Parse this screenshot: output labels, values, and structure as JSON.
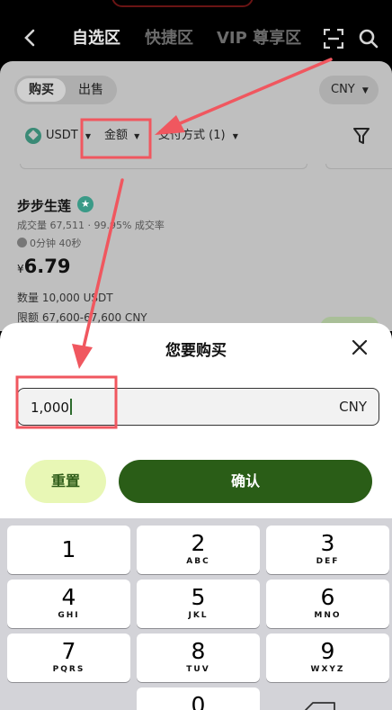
{
  "nav": {
    "tabs": [
      "自选区",
      "快捷区",
      "VIP 尊享区"
    ],
    "active_tab": "自选区"
  },
  "page": {
    "segment": [
      "购买",
      "出售"
    ],
    "currency_select": "CNY",
    "filters": {
      "coin": "USDT",
      "amount": "金额",
      "payment": "支付方式 (1)"
    },
    "merchant": {
      "name": "步步生莲",
      "stats": "成交量 67,511 · 99.95% 成交率",
      "time": "0分钟 40秒",
      "price_currency": "¥",
      "price": "6.79",
      "quantity": "数量 10,000 USDT",
      "limit": "限额 67,600-67,600 CNY"
    }
  },
  "sheet": {
    "title": "您要购买",
    "amount_value": "1,000",
    "amount_unit": "CNY",
    "reset_label": "重置",
    "confirm_label": "确认"
  },
  "keypad": {
    "keys": [
      {
        "digit": "1",
        "letters": ""
      },
      {
        "digit": "2",
        "letters": "ABC"
      },
      {
        "digit": "3",
        "letters": "DEF"
      },
      {
        "digit": "4",
        "letters": "GHI"
      },
      {
        "digit": "5",
        "letters": "JKL"
      },
      {
        "digit": "6",
        "letters": "MNO"
      },
      {
        "digit": "7",
        "letters": "PQRS"
      },
      {
        "digit": "8",
        "letters": "TUV"
      },
      {
        "digit": "9",
        "letters": "WXYZ"
      },
      {
        "digit": "0",
        "letters": ""
      }
    ]
  },
  "colors": {
    "confirm_bg": "#2a5d17",
    "reset_bg": "#e8f7b5",
    "annotation_red": "#f0575f"
  },
  "icons": [
    "back-icon",
    "scan-icon",
    "search-icon",
    "usdt-icon",
    "filter-icon",
    "verified-icon",
    "clock-icon",
    "close-icon",
    "backspace-icon"
  ]
}
